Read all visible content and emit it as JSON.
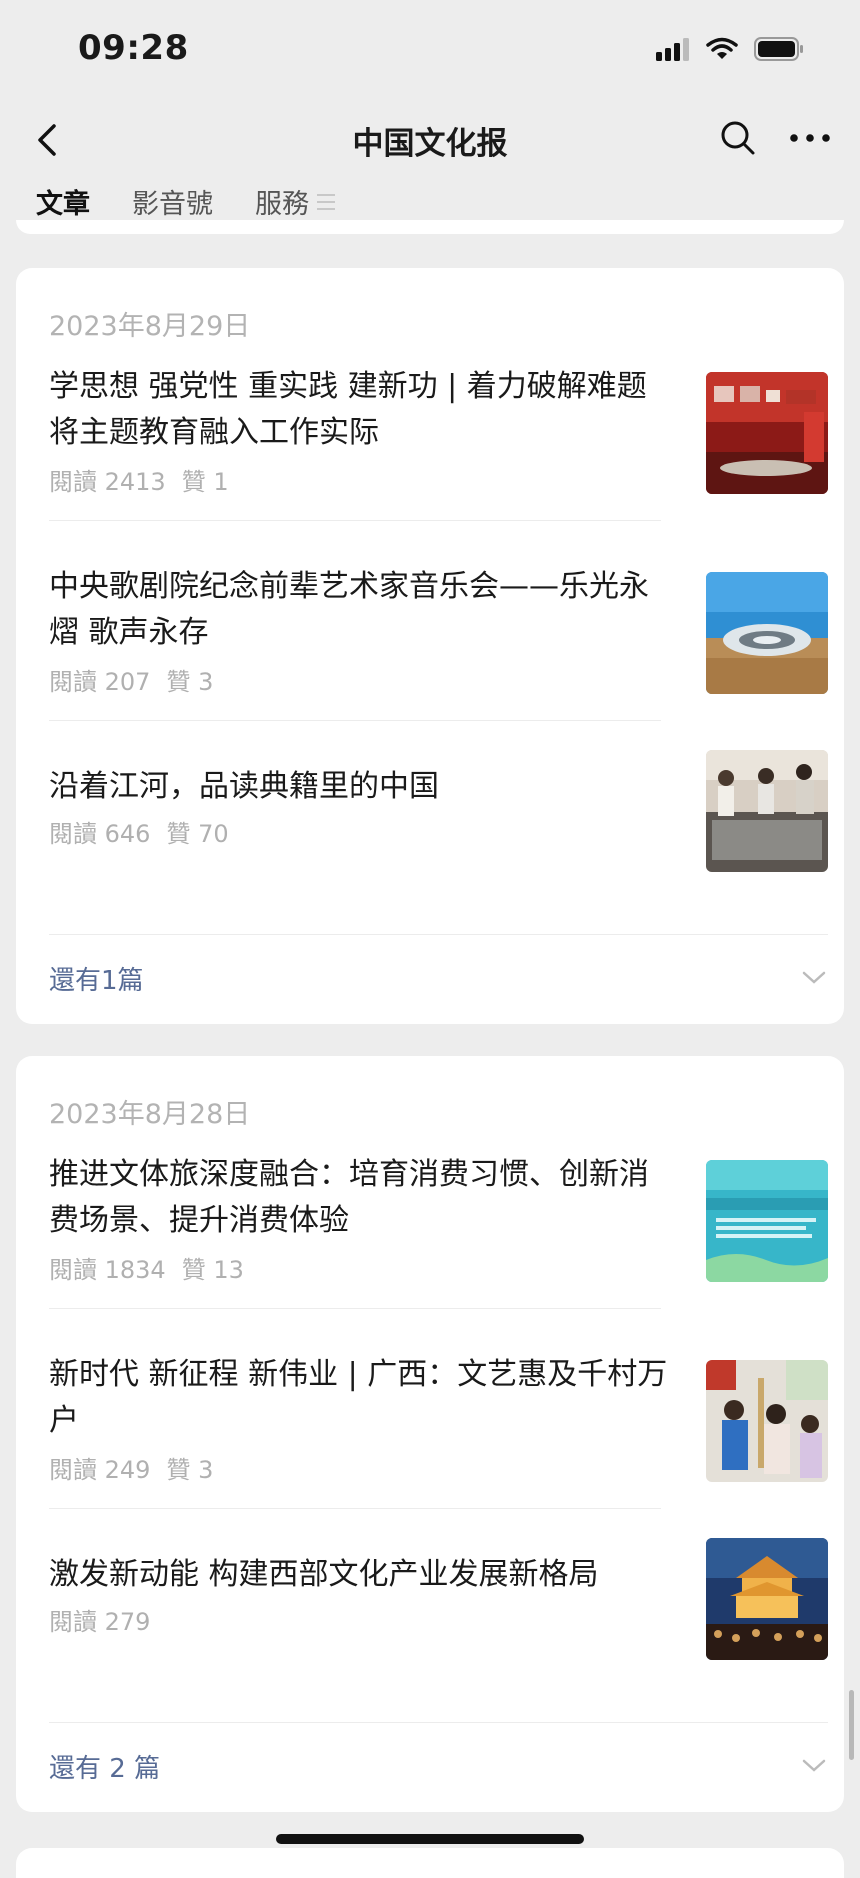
{
  "status": {
    "time": "09:28"
  },
  "nav": {
    "title": "中国文化报"
  },
  "tabs": [
    {
      "label": "文章"
    },
    {
      "label": "影音號"
    },
    {
      "label": "服務"
    }
  ],
  "groups": [
    {
      "date": "2023年8月29日",
      "items": [
        {
          "title": "学思想 强党性 重实践 建新功 | 着力破解难题 将主题教育融入工作实际",
          "reads": "閱讀 2413",
          "likes": "贊 1"
        },
        {
          "title": "中央歌剧院纪念前辈艺术家音乐会——乐光永熠 歌声永存",
          "reads": "閱讀 207",
          "likes": "贊 3"
        },
        {
          "title": "沿着江河，品读典籍里的中国",
          "reads": "閱讀 646",
          "likes": "贊 70"
        }
      ],
      "more_label": "還有1篇"
    },
    {
      "date": "2023年8月28日",
      "items": [
        {
          "title": "推进文体旅深度融合：培育消费习惯、创新消费场景、提升消费体验",
          "reads": "閱讀 1834",
          "likes": "贊 13"
        },
        {
          "title": "新时代 新征程 新伟业 | 广西：文艺惠及千村万户",
          "reads": "閱讀 249",
          "likes": "贊 3"
        },
        {
          "title": "激发新动能 构建西部文化产业发展新格局",
          "reads": "閱讀 279",
          "likes": ""
        }
      ],
      "more_label": "還有 2 篇"
    }
  ],
  "colors": {
    "link": "#576b95",
    "meta": "#b0b0b0",
    "background": "#ededed"
  },
  "icons": [
    "back-arrow-icon",
    "search-icon",
    "more-icon",
    "menu-lines-icon",
    "chevron-down-icon",
    "signal-icon",
    "wifi-icon",
    "battery-icon"
  ]
}
